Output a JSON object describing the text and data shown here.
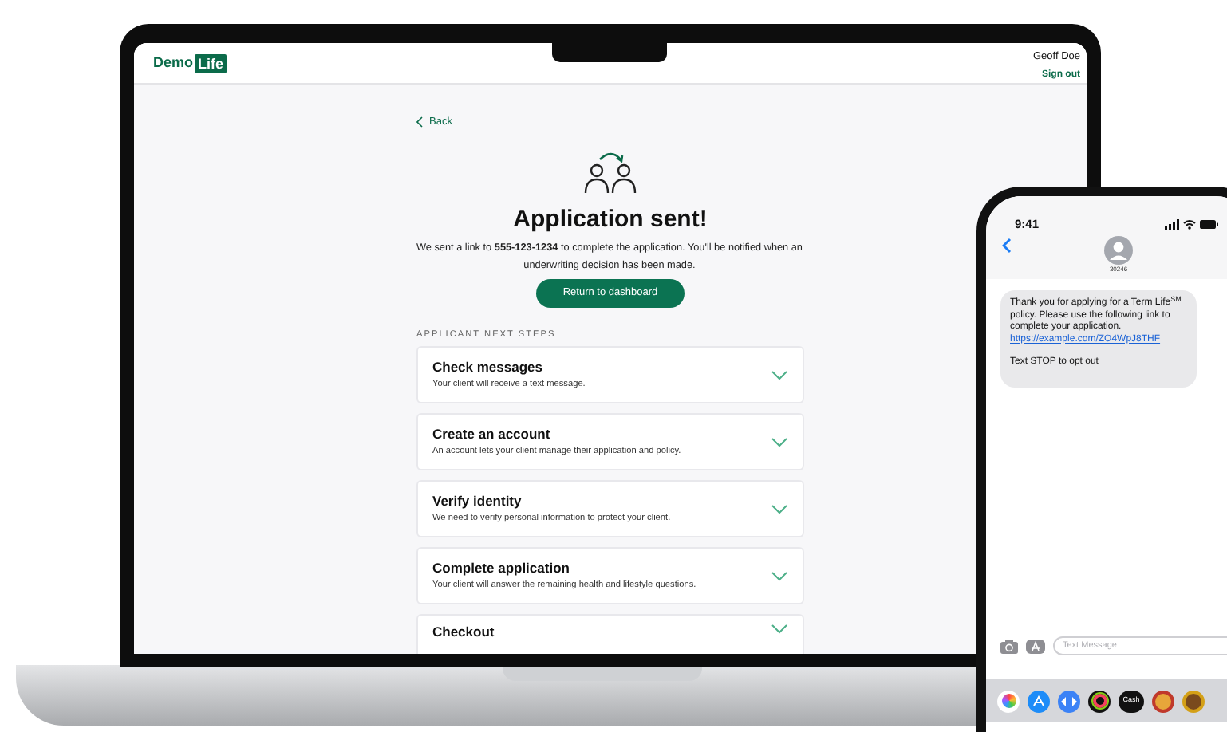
{
  "laptop": {
    "header": {
      "logo_word": "Demo",
      "logo_badge": "Life",
      "user_name": "Geoff Doe",
      "sign_out": "Sign out"
    },
    "back": "Back",
    "title": "Application sent!",
    "message": "We sent a link to **555-123-1234** to complete the application. You'll be notified when an underwriting decision has been made.",
    "button": "Return to dashboard",
    "section_label": "APPLICANT NEXT STEPS",
    "steps": [
      {
        "title": "Check messages",
        "description": "Your client will receive a text message.",
        "expanded": false
      },
      {
        "title": "Create an account",
        "description": "An account lets your client manage their application and policy.",
        "expanded": false
      },
      {
        "title": "Verify identity",
        "description": "We need to verify personal information to protect your client.",
        "expanded": false
      },
      {
        "title": "Complete application",
        "description": "Your client will answer the remaining health and lifestyle questions.",
        "expanded": false
      },
      {
        "title": "Checkout",
        "expanded": false
      }
    ]
  },
  "phone": {
    "time": "9:41",
    "contact": "30246",
    "message": "Thank you for applying for a Term Life$^{SM}$ policy. Please use the following link to complete your application.",
    "link": "https://example.com/ZO4WpJ8THF",
    "opt_out": "Text STOP to opt out",
    "input": {
      "placeholder": "Text Message"
    },
    "cash_label": "Cash"
  }
}
